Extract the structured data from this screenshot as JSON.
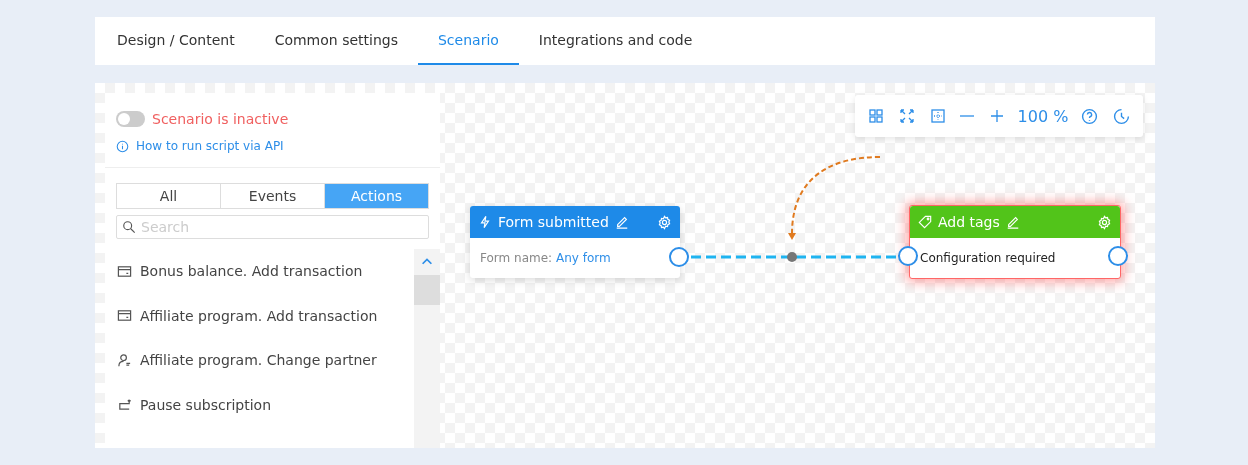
{
  "tabs": [
    {
      "label": "Design / Content",
      "selected": false
    },
    {
      "label": "Common settings",
      "selected": false
    },
    {
      "label": "Scenario",
      "selected": true
    },
    {
      "label": "Integrations and code",
      "selected": false
    }
  ],
  "panel": {
    "toggle": {
      "on": false,
      "label": "Scenario is inactive"
    },
    "help_link": "How to run script via API",
    "filters": [
      {
        "label": "All",
        "selected": false
      },
      {
        "label": "Events",
        "selected": false
      },
      {
        "label": "Actions",
        "selected": true
      }
    ],
    "search": {
      "placeholder": "Search"
    },
    "items": [
      {
        "kind": "card",
        "label": "Bonus balance. Add transaction"
      },
      {
        "kind": "card",
        "label": "Affiliate program. Add transaction"
      },
      {
        "kind": "person",
        "label": "Affiliate program. Change partner"
      },
      {
        "kind": "return",
        "label": "Pause subscription"
      }
    ]
  },
  "toolbar": {
    "zoom": "100 %"
  },
  "nodes": [
    {
      "kind": "trigger",
      "title": "Form submitted",
      "error": false,
      "field_label": "Form name:",
      "field_value": "Any form"
    },
    {
      "kind": "action",
      "title": "Add tags",
      "error": true,
      "body": "Configuration required"
    }
  ]
}
